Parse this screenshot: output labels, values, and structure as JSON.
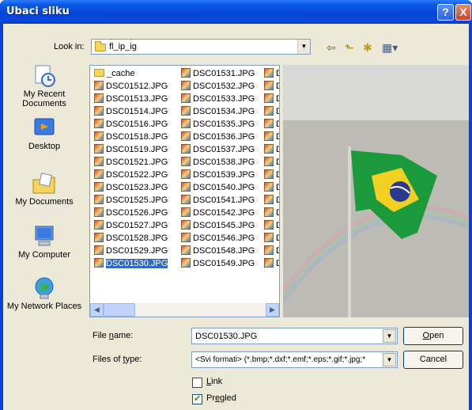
{
  "window": {
    "title": "Ubaci sliku",
    "help_label": "?",
    "close_label": "X"
  },
  "look_in": {
    "label": "Look in:",
    "folder": "fl_ip_ig"
  },
  "toolbar": {
    "back_icon": "back-arrow-icon",
    "up_icon": "up-folder-icon",
    "new_folder_icon": "new-folder-icon",
    "views_icon": "views-menu-icon"
  },
  "places": [
    {
      "label": "My Recent Documents",
      "icon": "recent-documents-icon"
    },
    {
      "label": "Desktop",
      "icon": "desktop-icon"
    },
    {
      "label": "My Documents",
      "icon": "my-documents-icon"
    },
    {
      "label": "My Computer",
      "icon": "my-computer-icon"
    },
    {
      "label": "My Network Places",
      "icon": "network-places-icon"
    }
  ],
  "files": {
    "col1": [
      "_cache",
      "DSC01512.JPG",
      "DSC01513.JPG",
      "DSC01514.JPG",
      "DSC01516.JPG",
      "DSC01518.JPG",
      "DSC01519.JPG",
      "DSC01521.JPG",
      "DSC01522.JPG",
      "DSC01523.JPG",
      "DSC01525.JPG",
      "DSC01526.JPG",
      "DSC01527.JPG",
      "DSC01528.JPG",
      "DSC01529.JPG",
      "DSC01530.JPG"
    ],
    "col2": [
      "DSC01531.JPG",
      "DSC01532.JPG",
      "DSC01533.JPG",
      "DSC01534.JPG",
      "DSC01535.JPG",
      "DSC01536.JPG",
      "DSC01537.JPG",
      "DSC01538.JPG",
      "DSC01539.JPG",
      "DSC01540.JPG",
      "DSC01541.JPG",
      "DSC01542.JPG",
      "DSC01545.JPG",
      "DSC01546.JPG",
      "DSC01548.JPG",
      "DSC01549.JPG"
    ],
    "col3": [
      "D",
      "D",
      "D",
      "D",
      "D",
      "D",
      "D",
      "D",
      "D",
      "D",
      "D",
      "D",
      "D",
      "D",
      "D",
      "D"
    ],
    "selected": "DSC01530.JPG"
  },
  "preview": {
    "subject": "brazil-flag-photo"
  },
  "file_name": {
    "label_pre": "File ",
    "label_u": "n",
    "label_post": "ame:",
    "value": "DSC01530.JPG"
  },
  "file_type": {
    "label_pre": "Files of ",
    "label_u": "t",
    "label_post": "ype:",
    "value": "<Svi formati> (*.bmp;*.dxf;*.emf;*.eps;*.gif;*.jpg;*"
  },
  "buttons": {
    "open_u": "O",
    "open_rest": "pen",
    "cancel": "Cancel"
  },
  "link": {
    "u": "L",
    "rest": "ink",
    "checked": false
  },
  "preview_toggle": {
    "pre": "Pr",
    "u": "e",
    "rest": "gled",
    "checked": true
  },
  "colors": {
    "title_blue": "#0a4adf",
    "selection": "#316ac5",
    "face": "#ece9d8"
  }
}
